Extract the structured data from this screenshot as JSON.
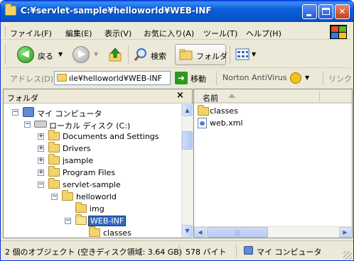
{
  "window": {
    "title": "C:¥servlet-sample¥helloworld¥WEB-INF"
  },
  "menubar": {
    "items": [
      "ファイル(F)",
      "編集(E)",
      "表示(V)",
      "お気に入り(A)",
      "ツール(T)",
      "ヘルプ(H)"
    ]
  },
  "toolbar": {
    "back_label": "戻る",
    "search_label": "検索",
    "folders_label": "フォルダ"
  },
  "addressbar": {
    "label": "アドレス(D)",
    "value": "ıle¥helloworld¥WEB-INF",
    "go_label": "移動",
    "norton_label": "Norton AntiVirus",
    "links_label": "リンク"
  },
  "folders_pane": {
    "title": "フォルダ",
    "close_glyph": "×",
    "tree": [
      {
        "label": "マイ コンピュータ",
        "expander": "−",
        "icon": "my-computer-icon"
      },
      {
        "label": "ローカル ディスク (C:)",
        "expander": "−",
        "icon": "local-disk-icon"
      },
      {
        "label": "Documents and Settings",
        "expander": "+",
        "icon": "folder-icon"
      },
      {
        "label": "Drivers",
        "expander": "+",
        "icon": "folder-icon"
      },
      {
        "label": "jsample",
        "expander": "+",
        "icon": "folder-icon"
      },
      {
        "label": "Program Files",
        "expander": "+",
        "icon": "folder-icon"
      },
      {
        "label": "servlet-sample",
        "expander": "−",
        "icon": "folder-icon"
      },
      {
        "label": "helloworld",
        "expander": "−",
        "icon": "folder-icon"
      },
      {
        "label": "img",
        "expander": "",
        "icon": "folder-icon"
      },
      {
        "label": "WEB-INF",
        "expander": "−",
        "icon": "open-folder-icon",
        "selected": true
      },
      {
        "label": "classes",
        "expander": "",
        "icon": "folder-icon"
      }
    ]
  },
  "file_pane": {
    "column_name": "名前",
    "files": [
      {
        "label": "classes",
        "icon": "folder-icon"
      },
      {
        "label": "web.xml",
        "icon": "xml-file-icon"
      }
    ]
  },
  "statusbar": {
    "objects": "2 個のオブジェクト (空きディスク領域: 3.64 GB)",
    "size": "578 バイト",
    "location": "マイ コンピュータ"
  }
}
